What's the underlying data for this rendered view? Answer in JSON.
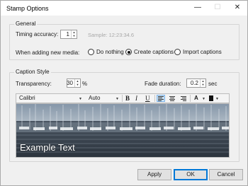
{
  "window": {
    "title": "Stamp Options",
    "controls": {
      "minimize": "—",
      "maximize": "☐",
      "close": "✕"
    }
  },
  "general": {
    "group_label": "General",
    "timing_label": "Timing accuracy:",
    "timing_value": "1",
    "sample_text": "Sample:   12:23:34.6",
    "new_media_label": "When adding new media:",
    "options": [
      {
        "label": "Do nothing",
        "selected": false
      },
      {
        "label": "Create captions",
        "selected": true
      },
      {
        "label": "Import captions",
        "selected": false
      }
    ]
  },
  "caption_style": {
    "group_label": "Caption Style",
    "transparency_label": "Transparency:",
    "transparency_value": "30",
    "transparency_unit": "%",
    "fade_label": "Fade duration:",
    "fade_value": "0.2",
    "fade_unit": "sec",
    "toolbar": {
      "font": "Calibri",
      "size": "Auto",
      "bold": "B",
      "italic": "I",
      "underline": "U",
      "font_color_glyph": "A",
      "active_alignment": "left"
    },
    "preview_text": "Example Text"
  },
  "buttons": {
    "apply": "Apply",
    "ok": "OK",
    "cancel": "Cancel"
  },
  "colors": {
    "accent": "#0078d7",
    "caption_text": "#ffffff"
  }
}
